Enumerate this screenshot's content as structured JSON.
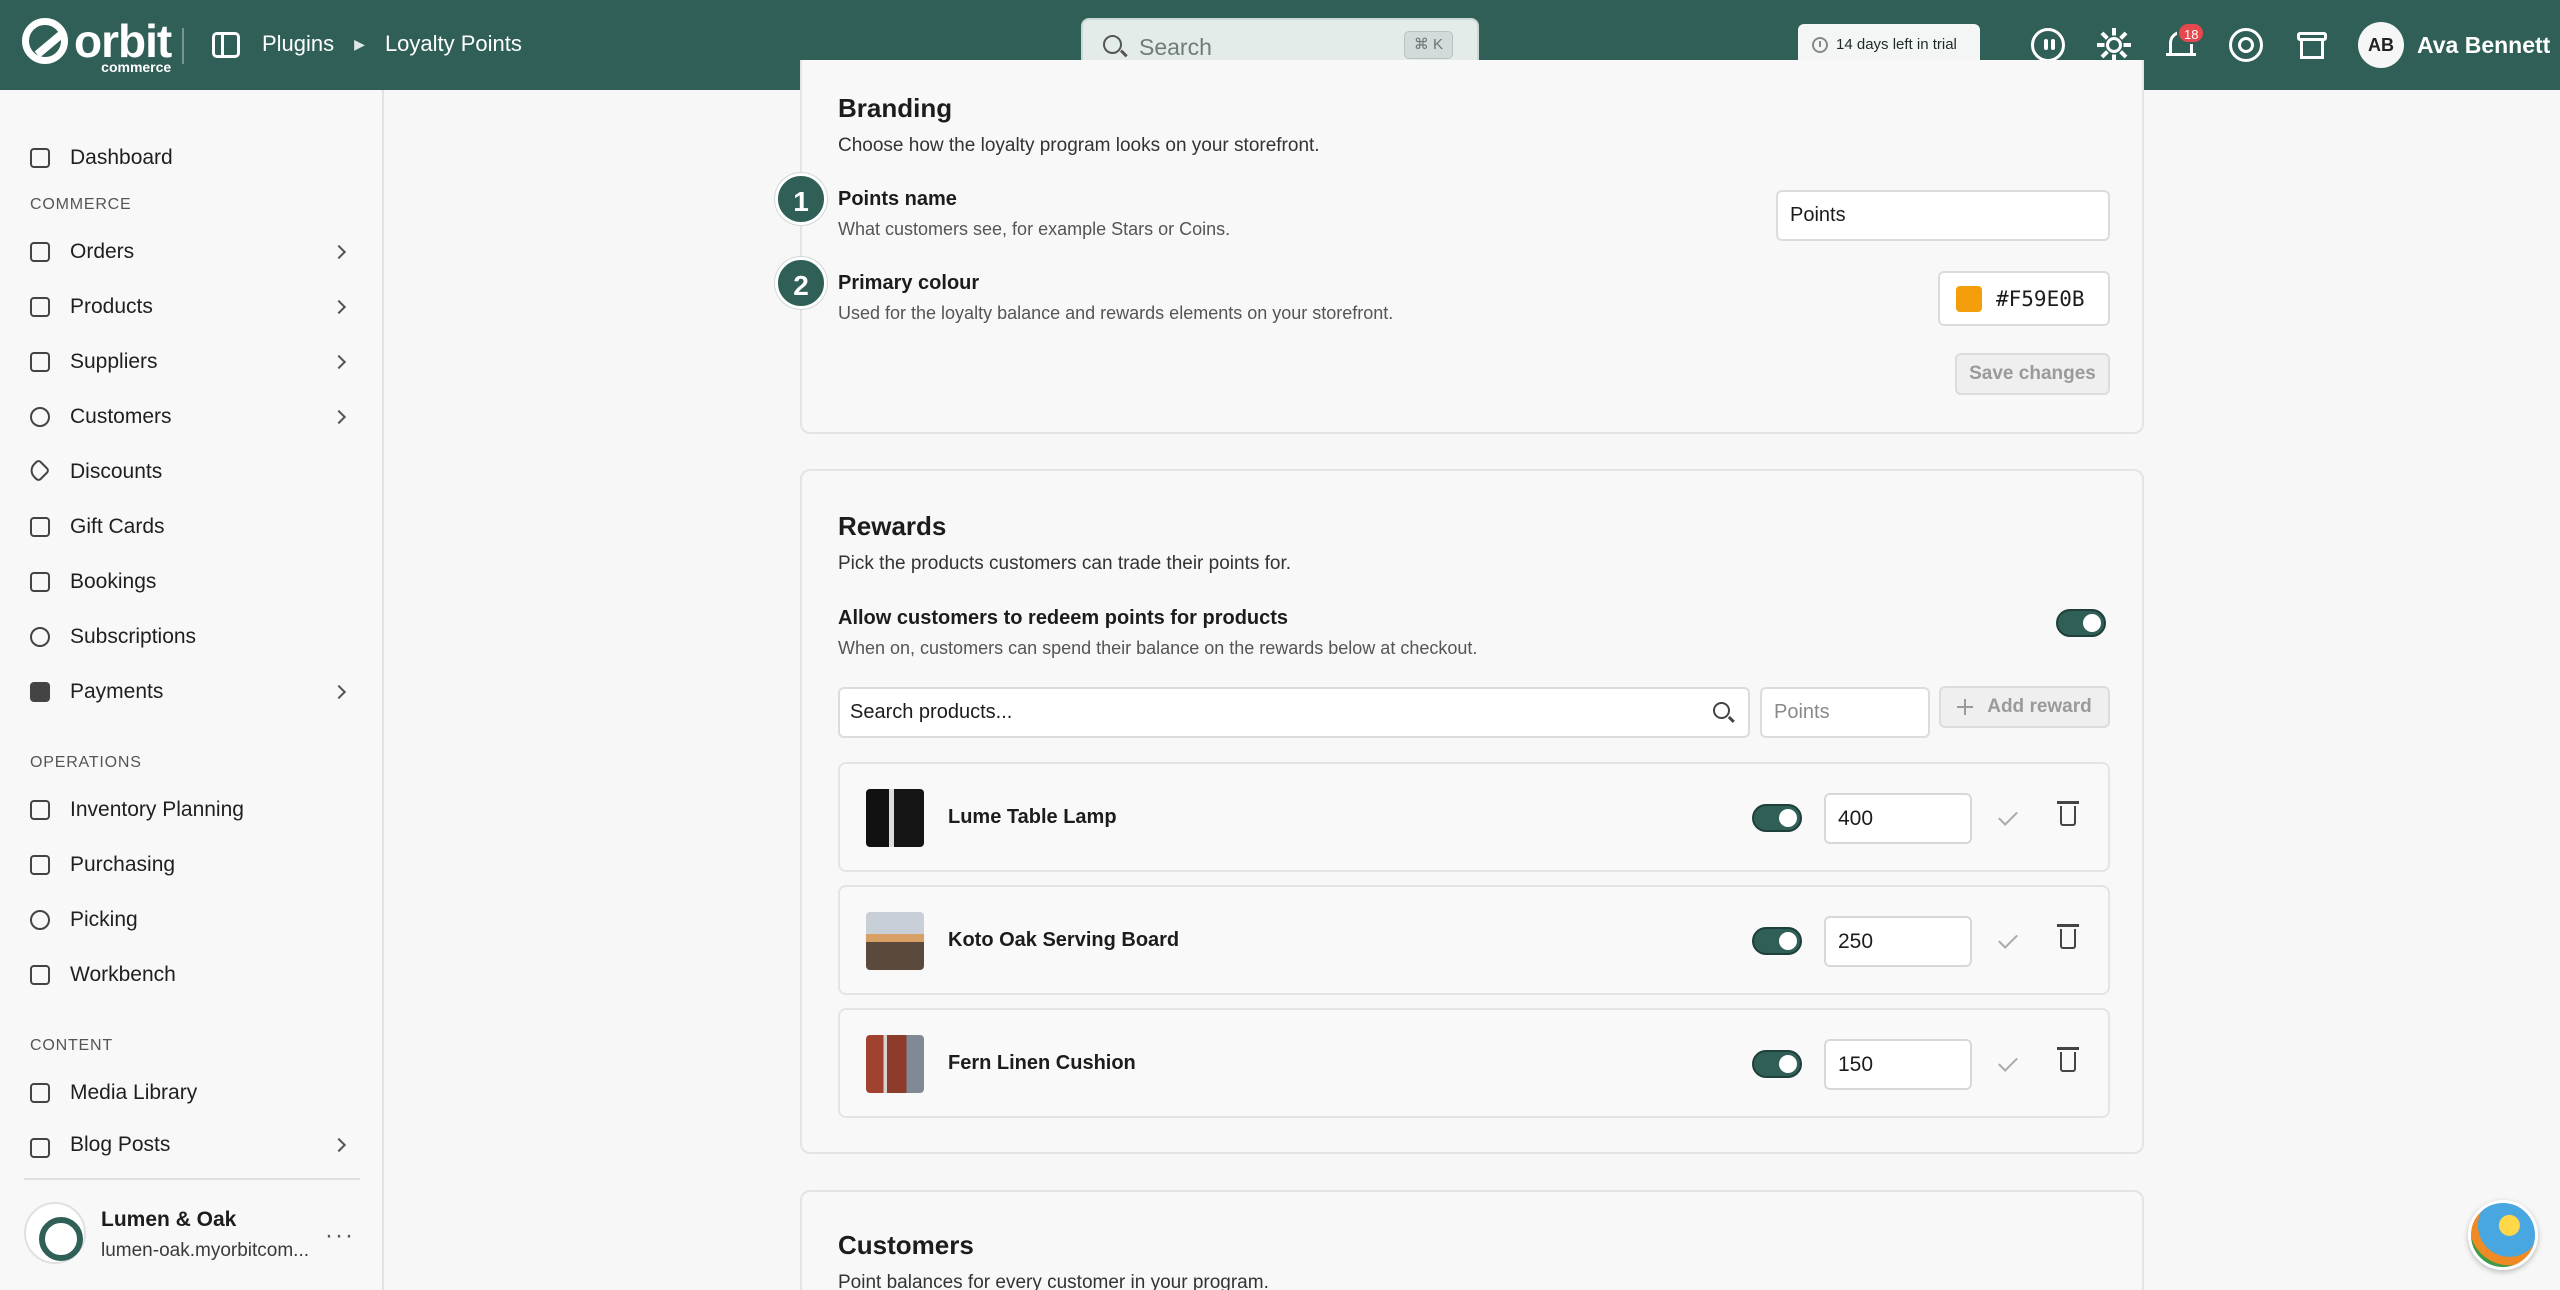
{
  "app": {
    "logo_text": "orbit",
    "logo_subtext": "commerce",
    "breadcrumb": [
      "Plugins",
      "Loyalty Points"
    ],
    "search_placeholder": "Search",
    "search_shortcut": "⌘ K",
    "trial_text": "14 days left in trial",
    "notification_count": "18",
    "user_initials": "AB",
    "user_name": "Ava Bennett",
    "accent_color": "#2f5f57"
  },
  "sidebar": {
    "items": [
      {
        "label": "Dashboard",
        "icon": "dashboard-icon"
      },
      {
        "label": "Orders",
        "icon": "orders-icon",
        "has_children": true
      },
      {
        "label": "Products",
        "icon": "products-icon",
        "has_children": true
      },
      {
        "label": "Suppliers",
        "icon": "suppliers-icon",
        "has_children": true
      },
      {
        "label": "Customers",
        "icon": "customers-icon",
        "has_children": true
      },
      {
        "label": "Discounts",
        "icon": "tag-icon"
      },
      {
        "label": "Gift Cards",
        "icon": "gift-icon"
      },
      {
        "label": "Bookings",
        "icon": "calendar-icon"
      },
      {
        "label": "Subscriptions",
        "icon": "refresh-icon"
      },
      {
        "label": "Payments",
        "icon": "credit-card-icon",
        "has_children": true
      },
      {
        "label": "Inventory Planning",
        "icon": "clipboard-icon"
      },
      {
        "label": "Purchasing",
        "icon": "box-icon"
      },
      {
        "label": "Picking",
        "icon": "map-pin-icon"
      },
      {
        "label": "Workbench",
        "icon": "box-icon"
      },
      {
        "label": "Media Library",
        "icon": "image-icon"
      },
      {
        "label": "Blog Posts",
        "icon": "document-icon",
        "has_children": true
      }
    ],
    "sections": [
      "COMMERCE",
      "OPERATIONS",
      "CONTENT"
    ],
    "store": {
      "name": "Lumen & Oak",
      "url": "lumen-oak.myorbitcom..."
    }
  },
  "branding": {
    "title": "Branding",
    "subtitle": "Choose how the loyalty program looks on your storefront.",
    "points_name_step": "1",
    "points_name_label": "Points name",
    "points_name_hint": "What customers see, for example Stars or Coins.",
    "points_name_value": "Points",
    "colour_step": "2",
    "colour_label": "Primary colour",
    "colour_hint": "Used for the loyalty balance and rewards elements on your storefront.",
    "colour_value": "#F59E0B",
    "save_label": "Save changes"
  },
  "rewards": {
    "title": "Rewards",
    "subtitle": "Pick the products customers can trade their points for.",
    "allow_label": "Allow customers to redeem points for products",
    "allow_hint": "When on, customers can spend their balance on the rewards below at checkout.",
    "allow_enabled": true,
    "search_placeholder": "Search products...",
    "points_placeholder": "Points",
    "add_label": "Add reward",
    "items": [
      {
        "name": "Lume Table Lamp",
        "points": "400",
        "enabled": true
      },
      {
        "name": "Koto Oak Serving Board",
        "points": "250",
        "enabled": true
      },
      {
        "name": "Fern Linen Cushion",
        "points": "150",
        "enabled": true
      }
    ]
  },
  "customers": {
    "title": "Customers",
    "subtitle": "Point balances for every customer in your program."
  }
}
